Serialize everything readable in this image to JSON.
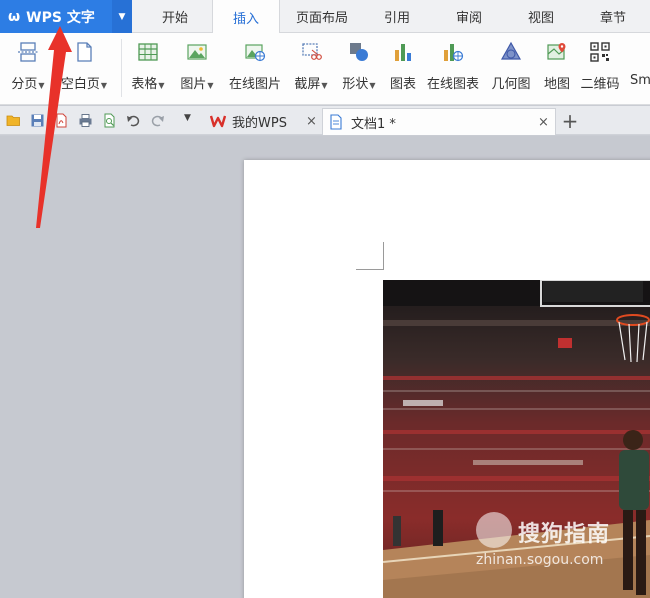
{
  "app": {
    "name": "WPS 文字",
    "accent": "#2d7de4"
  },
  "menu": {
    "tabs": [
      {
        "label": "开始"
      },
      {
        "label": "插入",
        "active": true
      },
      {
        "label": "页面布局"
      },
      {
        "label": "引用"
      },
      {
        "label": "审阅"
      },
      {
        "label": "视图"
      },
      {
        "label": "章节"
      }
    ]
  },
  "ribbon": {
    "items": [
      {
        "label": "分页",
        "icon": "page-break-icon",
        "dropdown": true
      },
      {
        "label": "空白页",
        "icon": "blank-page-icon",
        "dropdown": true
      },
      {
        "label": "表格",
        "icon": "table-icon",
        "dropdown": true
      },
      {
        "label": "图片",
        "icon": "picture-icon",
        "dropdown": true
      },
      {
        "label": "在线图片",
        "icon": "online-picture-icon"
      },
      {
        "label": "截屏",
        "icon": "screenshot-icon",
        "dropdown": true
      },
      {
        "label": "形状",
        "icon": "shape-icon",
        "dropdown": true
      },
      {
        "label": "图表",
        "icon": "chart-icon"
      },
      {
        "label": "在线图表",
        "icon": "online-chart-icon"
      },
      {
        "label": "几何图",
        "icon": "geometry-icon"
      },
      {
        "label": "地图",
        "icon": "map-icon"
      },
      {
        "label": "二维码",
        "icon": "qrcode-icon"
      },
      {
        "label": "Sm",
        "icon": "smart-art-icon"
      }
    ]
  },
  "doc_tabs": [
    {
      "label": "我的WPS",
      "icon": "wps-logo-icon"
    },
    {
      "label": "文档1 *",
      "icon": "document-icon",
      "active": true
    }
  ],
  "watermark": {
    "main": "搜狗指南",
    "sub": "zhinan.sogou.com"
  }
}
